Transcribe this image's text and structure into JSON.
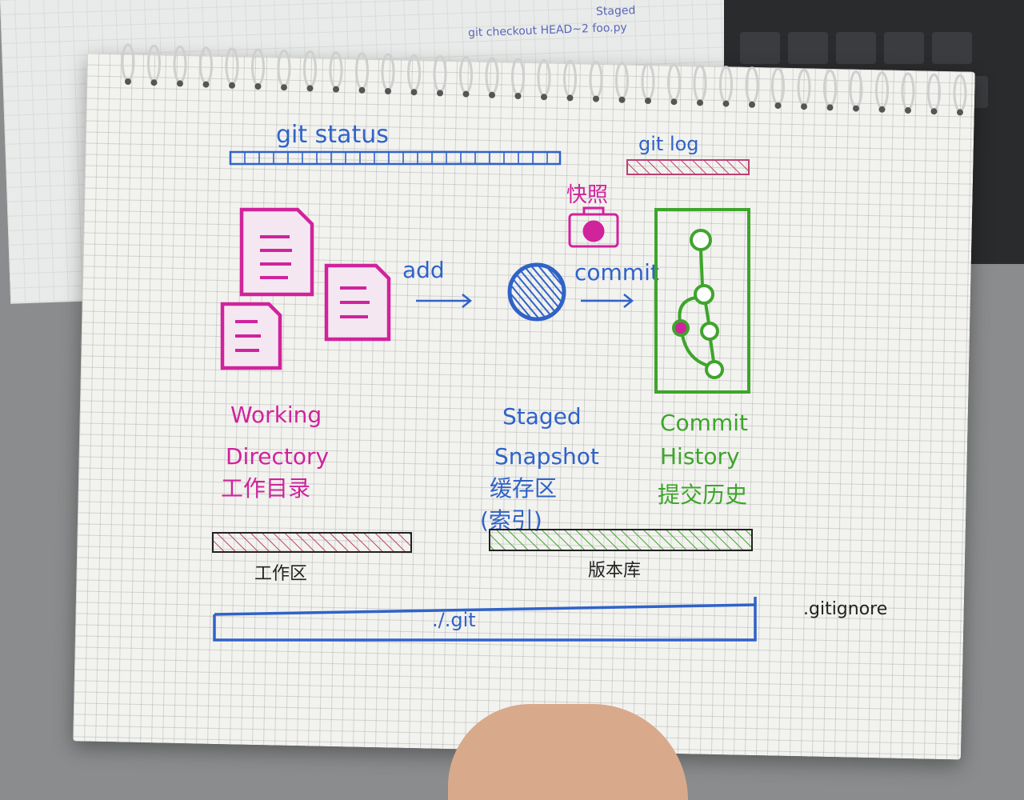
{
  "colors": {
    "blue": "#2f63c8",
    "magenta": "#d0239c",
    "green": "#3ea52b",
    "pink_bar": "#b9426f",
    "dark": "#222222"
  },
  "background_notes": {
    "line1": "git checkout HEAD~2 foo.py",
    "line2": "Staged"
  },
  "top": {
    "git_status": "git status",
    "git_log": "git log",
    "snapshot_cn": "快照"
  },
  "arrows": {
    "add": "add",
    "commit": "commit"
  },
  "sections": {
    "working": {
      "line1": "Working",
      "line2": "Directory",
      "line3": "工作目录"
    },
    "staged": {
      "line1": "Staged",
      "line2": "Snapshot",
      "line3": "缓存区",
      "line4": "(索引)"
    },
    "history": {
      "line1": "Commit",
      "line2": "History",
      "line3": "提交历史"
    }
  },
  "bottom": {
    "workspace": "工作区",
    "repository": "版本库",
    "git_dir": "./.git",
    "gitignore": ".gitignore"
  },
  "icons": {
    "files": "document-icon",
    "staged": "hatched-disk-icon",
    "camera": "camera-icon",
    "history": "commit-graph-icon"
  }
}
